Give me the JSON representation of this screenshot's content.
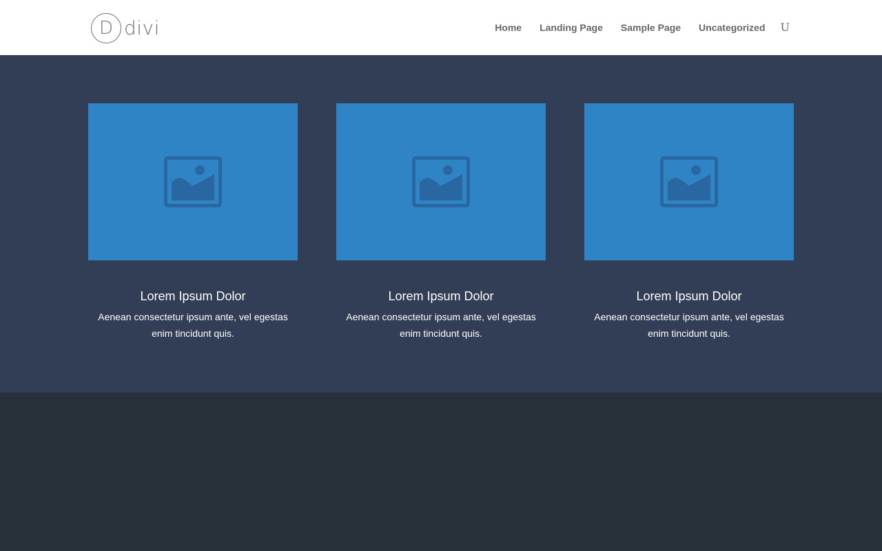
{
  "header": {
    "logo": {
      "mark": "D",
      "text": "divi"
    },
    "nav": [
      {
        "label": "Home"
      },
      {
        "label": "Landing Page"
      },
      {
        "label": "Sample Page"
      },
      {
        "label": "Uncategorized"
      }
    ],
    "search_icon_glyph": "U"
  },
  "features": {
    "cards": [
      {
        "title": "Lorem Ipsum Dolor",
        "description": "Aenean consectetur ipsum ante, vel egestas enim tincidunt quis.",
        "image_icon": "image-placeholder-icon"
      },
      {
        "title": "Lorem Ipsum Dolor",
        "description": "Aenean consectetur ipsum ante, vel egestas enim tincidunt quis.",
        "image_icon": "image-placeholder-icon"
      },
      {
        "title": "Lorem Ipsum Dolor",
        "description": "Aenean consectetur ipsum ante, vel egestas enim tincidunt quis.",
        "image_icon": "image-placeholder-icon"
      }
    ]
  },
  "colors": {
    "header_bg": "#ffffff",
    "section_bg": "#313e55",
    "image_bg": "#2e84c5",
    "image_icon": "#2867a1",
    "footer_bg": "#283039",
    "nav_text": "#666666"
  }
}
